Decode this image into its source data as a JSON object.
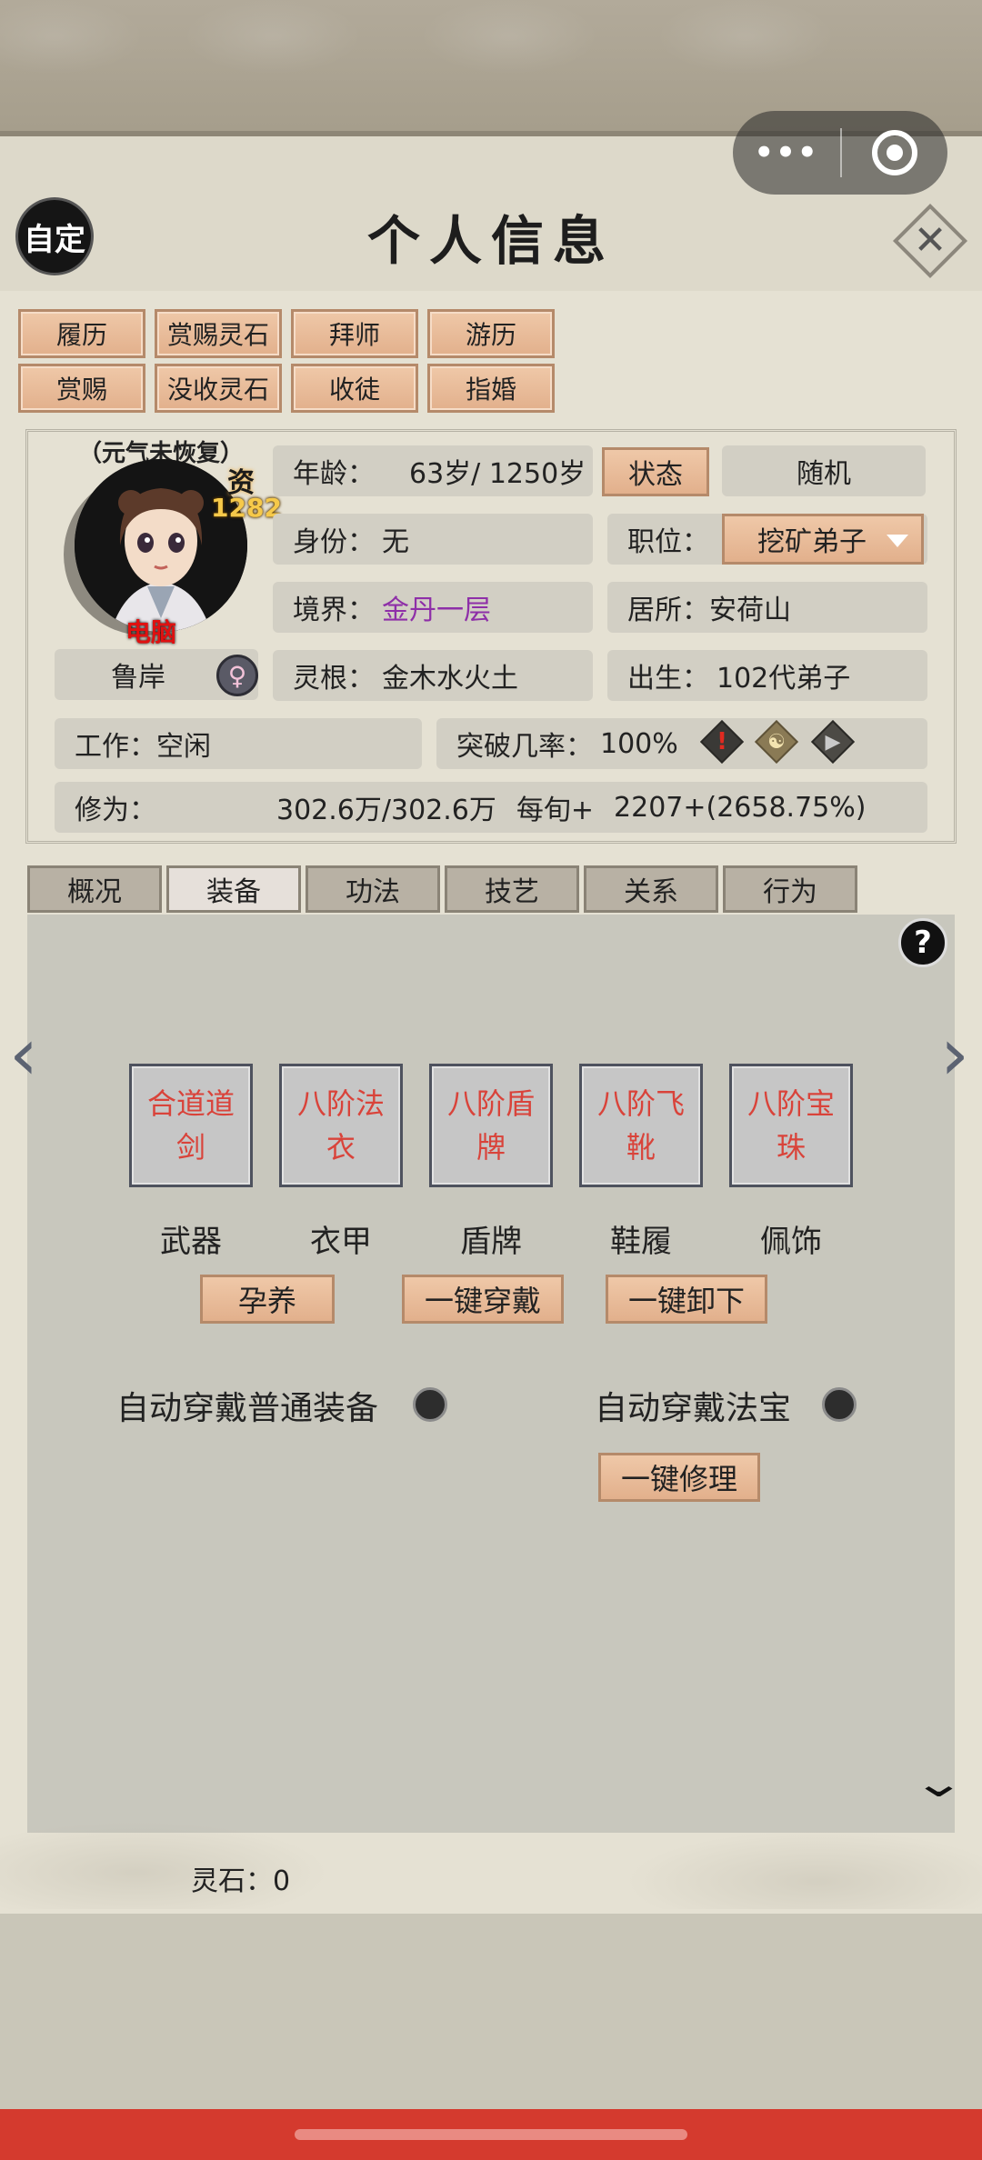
{
  "header": {
    "auto_label": "自定",
    "title": "个人信息",
    "capsule_more": "•••",
    "close_glyph": "✕"
  },
  "actions_row1": [
    "履历",
    "赏赐灵石",
    "拜师",
    "游历"
  ],
  "actions_row2": [
    "赏赐",
    "没收灵石",
    "收徒",
    "指婚"
  ],
  "avatar": {
    "status": "（元气未恢复）",
    "zi_char": "资",
    "zi_value": "1282",
    "tag": "电脑",
    "name": "鲁岸",
    "gender_glyph": "♀"
  },
  "info": {
    "age_label": "年龄：",
    "age_value": "63岁/ 1250岁",
    "state_button": "状态",
    "random_button": "随机",
    "identity_label": "身份：",
    "identity_value": "无",
    "position_label": "职位：",
    "position_value": "挖矿弟子",
    "realm_label": "境界：",
    "realm_value": "金丹一层",
    "residence": "居所：安荷山",
    "root_label": "灵根：",
    "root_value": "金木水火土",
    "birth_label": "出生：",
    "birth_value": "102代弟子",
    "work": "工作：空闲",
    "break_label": "突破几率：",
    "break_value": "100%",
    "cultivation_label": "修为：",
    "cultivation_value": "302.6万/302.6万",
    "per_round_label": "每旬+",
    "per_round_value": "2207+(2658.75%)"
  },
  "tabs": [
    "概况",
    "装备",
    "功法",
    "技艺",
    "关系",
    "行为"
  ],
  "active_tab": "装备",
  "equipment": {
    "slots": [
      {
        "item": "合道道剑",
        "line1": "合道道",
        "line2": "剑",
        "label": "武器"
      },
      {
        "item": "八阶法衣",
        "line1": "八阶法",
        "line2": "衣",
        "label": "衣甲"
      },
      {
        "item": "八阶盾牌",
        "line1": "八阶盾",
        "line2": "牌",
        "label": "盾牌"
      },
      {
        "item": "八阶飞靴",
        "line1": "八阶飞",
        "line2": "靴",
        "label": "鞋履"
      },
      {
        "item": "八阶宝珠",
        "line1": "八阶宝",
        "line2": "珠",
        "label": "佩饰"
      }
    ],
    "nurture_button": "孕养",
    "equip_all_button": "一键穿戴",
    "unequip_all_button": "一键卸下",
    "auto_normal_label": "自动穿戴普通装备",
    "auto_treasure_label": "自动穿戴法宝",
    "repair_button": "一键修理",
    "help_glyph": "?"
  },
  "footer": {
    "spirit_stone": "灵石：0"
  },
  "colors": {
    "accent_button": "#e8bc9a",
    "realm_text": "#8e2fa8",
    "item_text": "#d9433a",
    "bottom_bar": "#d43a2e"
  }
}
